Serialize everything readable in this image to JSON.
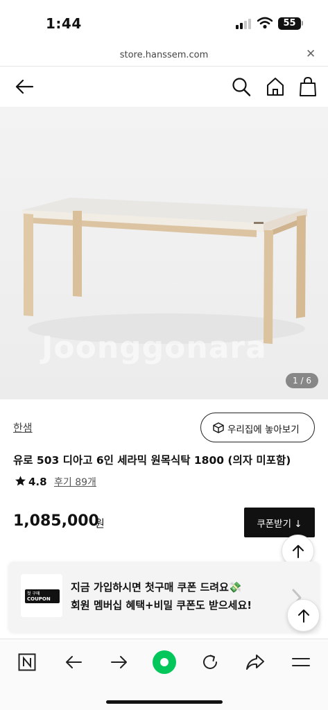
{
  "status_bar": {
    "time": "1:44",
    "battery": "55"
  },
  "browser": {
    "url": "store.hanssem.com"
  },
  "header": {
    "icons": [
      "back-arrow-icon",
      "search-icon",
      "home-icon",
      "shopping-bag-icon"
    ]
  },
  "gallery": {
    "watermark": "Joonggonara",
    "counter": "1 / 6"
  },
  "product": {
    "brand": "한샘",
    "view_in_room_label": "우리집에 놓아보기",
    "title": "유로 503 디아고 6인 세라믹 원목식탁 1800 (의자 미포함)",
    "rating": "4.8",
    "reviews_label": "후기 89개",
    "price": "1,085,000",
    "currency": "원",
    "coupon_button": "쿠폰받기 ↓"
  },
  "banner": {
    "ticket_small": "첫 구매",
    "ticket_big": "COUPON",
    "line1": "지금 가입하시면 첫구매 쿠폰 드려요💸",
    "line2": "회원 멤버십 혜택+비밀 쿠폰도 받으세요!"
  },
  "toolbar": {
    "icons": [
      "naver-n-icon",
      "back-icon",
      "forward-icon",
      "green-dot-icon",
      "refresh-icon",
      "share-icon",
      "menu-icon"
    ]
  },
  "colors": {
    "accent_green": "#03c75a",
    "black": "#111111",
    "banner_bg": "#f4f4f4"
  }
}
